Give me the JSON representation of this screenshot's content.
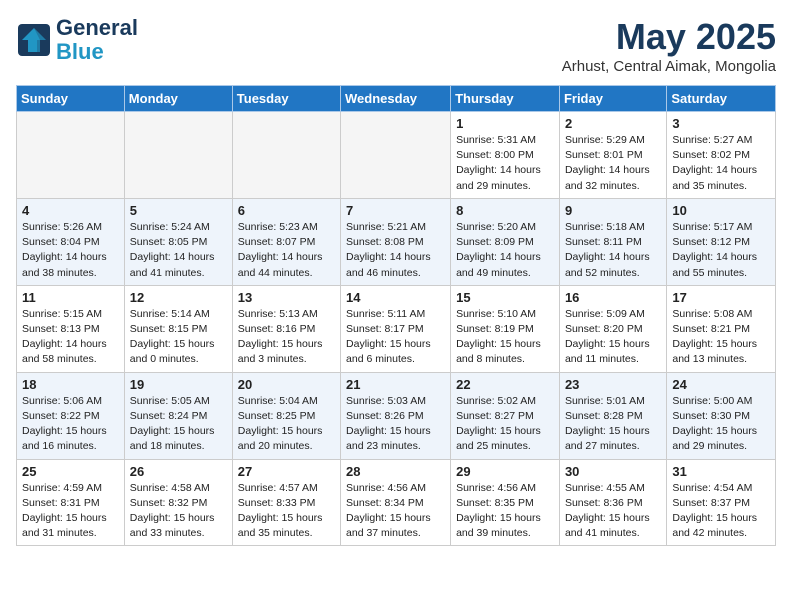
{
  "header": {
    "logo_line1": "General",
    "logo_line2": "Blue",
    "month": "May 2025",
    "location": "Arhust, Central Aimak, Mongolia"
  },
  "weekdays": [
    "Sunday",
    "Monday",
    "Tuesday",
    "Wednesday",
    "Thursday",
    "Friday",
    "Saturday"
  ],
  "weeks": [
    [
      {
        "day": "",
        "info": ""
      },
      {
        "day": "",
        "info": ""
      },
      {
        "day": "",
        "info": ""
      },
      {
        "day": "",
        "info": ""
      },
      {
        "day": "1",
        "info": "Sunrise: 5:31 AM\nSunset: 8:00 PM\nDaylight: 14 hours\nand 29 minutes."
      },
      {
        "day": "2",
        "info": "Sunrise: 5:29 AM\nSunset: 8:01 PM\nDaylight: 14 hours\nand 32 minutes."
      },
      {
        "day": "3",
        "info": "Sunrise: 5:27 AM\nSunset: 8:02 PM\nDaylight: 14 hours\nand 35 minutes."
      }
    ],
    [
      {
        "day": "4",
        "info": "Sunrise: 5:26 AM\nSunset: 8:04 PM\nDaylight: 14 hours\nand 38 minutes."
      },
      {
        "day": "5",
        "info": "Sunrise: 5:24 AM\nSunset: 8:05 PM\nDaylight: 14 hours\nand 41 minutes."
      },
      {
        "day": "6",
        "info": "Sunrise: 5:23 AM\nSunset: 8:07 PM\nDaylight: 14 hours\nand 44 minutes."
      },
      {
        "day": "7",
        "info": "Sunrise: 5:21 AM\nSunset: 8:08 PM\nDaylight: 14 hours\nand 46 minutes."
      },
      {
        "day": "8",
        "info": "Sunrise: 5:20 AM\nSunset: 8:09 PM\nDaylight: 14 hours\nand 49 minutes."
      },
      {
        "day": "9",
        "info": "Sunrise: 5:18 AM\nSunset: 8:11 PM\nDaylight: 14 hours\nand 52 minutes."
      },
      {
        "day": "10",
        "info": "Sunrise: 5:17 AM\nSunset: 8:12 PM\nDaylight: 14 hours\nand 55 minutes."
      }
    ],
    [
      {
        "day": "11",
        "info": "Sunrise: 5:15 AM\nSunset: 8:13 PM\nDaylight: 14 hours\nand 58 minutes."
      },
      {
        "day": "12",
        "info": "Sunrise: 5:14 AM\nSunset: 8:15 PM\nDaylight: 15 hours\nand 0 minutes."
      },
      {
        "day": "13",
        "info": "Sunrise: 5:13 AM\nSunset: 8:16 PM\nDaylight: 15 hours\nand 3 minutes."
      },
      {
        "day": "14",
        "info": "Sunrise: 5:11 AM\nSunset: 8:17 PM\nDaylight: 15 hours\nand 6 minutes."
      },
      {
        "day": "15",
        "info": "Sunrise: 5:10 AM\nSunset: 8:19 PM\nDaylight: 15 hours\nand 8 minutes."
      },
      {
        "day": "16",
        "info": "Sunrise: 5:09 AM\nSunset: 8:20 PM\nDaylight: 15 hours\nand 11 minutes."
      },
      {
        "day": "17",
        "info": "Sunrise: 5:08 AM\nSunset: 8:21 PM\nDaylight: 15 hours\nand 13 minutes."
      }
    ],
    [
      {
        "day": "18",
        "info": "Sunrise: 5:06 AM\nSunset: 8:22 PM\nDaylight: 15 hours\nand 16 minutes."
      },
      {
        "day": "19",
        "info": "Sunrise: 5:05 AM\nSunset: 8:24 PM\nDaylight: 15 hours\nand 18 minutes."
      },
      {
        "day": "20",
        "info": "Sunrise: 5:04 AM\nSunset: 8:25 PM\nDaylight: 15 hours\nand 20 minutes."
      },
      {
        "day": "21",
        "info": "Sunrise: 5:03 AM\nSunset: 8:26 PM\nDaylight: 15 hours\nand 23 minutes."
      },
      {
        "day": "22",
        "info": "Sunrise: 5:02 AM\nSunset: 8:27 PM\nDaylight: 15 hours\nand 25 minutes."
      },
      {
        "day": "23",
        "info": "Sunrise: 5:01 AM\nSunset: 8:28 PM\nDaylight: 15 hours\nand 27 minutes."
      },
      {
        "day": "24",
        "info": "Sunrise: 5:00 AM\nSunset: 8:30 PM\nDaylight: 15 hours\nand 29 minutes."
      }
    ],
    [
      {
        "day": "25",
        "info": "Sunrise: 4:59 AM\nSunset: 8:31 PM\nDaylight: 15 hours\nand 31 minutes."
      },
      {
        "day": "26",
        "info": "Sunrise: 4:58 AM\nSunset: 8:32 PM\nDaylight: 15 hours\nand 33 minutes."
      },
      {
        "day": "27",
        "info": "Sunrise: 4:57 AM\nSunset: 8:33 PM\nDaylight: 15 hours\nand 35 minutes."
      },
      {
        "day": "28",
        "info": "Sunrise: 4:56 AM\nSunset: 8:34 PM\nDaylight: 15 hours\nand 37 minutes."
      },
      {
        "day": "29",
        "info": "Sunrise: 4:56 AM\nSunset: 8:35 PM\nDaylight: 15 hours\nand 39 minutes."
      },
      {
        "day": "30",
        "info": "Sunrise: 4:55 AM\nSunset: 8:36 PM\nDaylight: 15 hours\nand 41 minutes."
      },
      {
        "day": "31",
        "info": "Sunrise: 4:54 AM\nSunset: 8:37 PM\nDaylight: 15 hours\nand 42 minutes."
      }
    ]
  ]
}
